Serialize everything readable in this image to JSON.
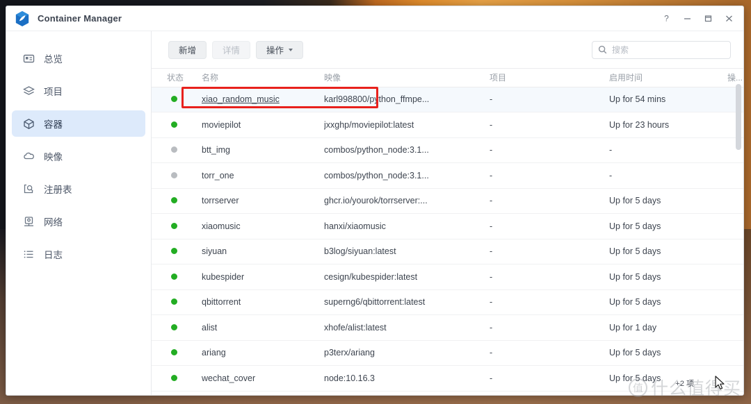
{
  "window": {
    "app_title": "Container Manager",
    "logo_icon": "synology-container-hexagon-logo",
    "controls": [
      {
        "name": "help-button",
        "icon": "question-mark-icon",
        "glyph": "?"
      },
      {
        "name": "minimize-button",
        "icon": "minimize-icon",
        "glyph": "–"
      },
      {
        "name": "maximize-button",
        "icon": "maximize-icon",
        "glyph": "□"
      },
      {
        "name": "close-button",
        "icon": "close-icon",
        "glyph": "×"
      }
    ]
  },
  "sidebar": {
    "items": [
      {
        "label": "总览",
        "icon": "overview-card-icon",
        "active": false
      },
      {
        "label": "项目",
        "icon": "layers-project-icon",
        "active": false
      },
      {
        "label": "容器",
        "icon": "cube-container-icon",
        "active": true
      },
      {
        "label": "映像",
        "icon": "cloud-image-icon",
        "active": false
      },
      {
        "label": "注册表",
        "icon": "registry-search-icon",
        "active": false
      },
      {
        "label": "网络",
        "icon": "network-icon",
        "active": false
      },
      {
        "label": "日志",
        "icon": "log-list-icon",
        "active": false
      }
    ]
  },
  "toolbar": {
    "create_label": "新增",
    "details_label": "详情",
    "details_disabled": true,
    "actions_label": "操作",
    "actions_has_caret": true,
    "search_placeholder": "搜索",
    "search_value": ""
  },
  "table": {
    "columns": [
      {
        "key": "status",
        "label": "状态"
      },
      {
        "key": "name",
        "label": "名称"
      },
      {
        "key": "image",
        "label": "映像"
      },
      {
        "key": "project",
        "label": "项目"
      },
      {
        "key": "uptime",
        "label": "启用时间"
      },
      {
        "key": "action",
        "label": "操..."
      },
      {
        "key": "cog",
        "label": ""
      }
    ],
    "rows": [
      {
        "status": "up",
        "name": "xiao_random_music",
        "image": "karl998800/python_ffmpe...",
        "project": "-",
        "uptime": "Up for 54 mins",
        "selected": true,
        "name_underlined": true
      },
      {
        "status": "up",
        "name": "moviepilot",
        "image": "jxxghp/moviepilot:latest",
        "project": "-",
        "uptime": "Up for 23 hours",
        "selected": false,
        "name_underlined": false
      },
      {
        "status": "down",
        "name": "btt_img",
        "image": "combos/python_node:3.1...",
        "project": "-",
        "uptime": "-",
        "selected": false,
        "name_underlined": false
      },
      {
        "status": "down",
        "name": "torr_one",
        "image": "combos/python_node:3.1...",
        "project": "-",
        "uptime": "-",
        "selected": false,
        "name_underlined": false
      },
      {
        "status": "up",
        "name": "torrserver",
        "image": "ghcr.io/yourok/torrserver:...",
        "project": "-",
        "uptime": "Up for 5 days",
        "selected": false,
        "name_underlined": false
      },
      {
        "status": "up",
        "name": "xiaomusic",
        "image": "hanxi/xiaomusic",
        "project": "-",
        "uptime": "Up for 5 days",
        "selected": false,
        "name_underlined": false
      },
      {
        "status": "up",
        "name": "siyuan",
        "image": "b3log/siyuan:latest",
        "project": "-",
        "uptime": "Up for 5 days",
        "selected": false,
        "name_underlined": false
      },
      {
        "status": "up",
        "name": "kubespider",
        "image": "cesign/kubespider:latest",
        "project": "-",
        "uptime": "Up for 5 days",
        "selected": false,
        "name_underlined": false
      },
      {
        "status": "up",
        "name": "qbittorrent",
        "image": "superng6/qbittorrent:latest",
        "project": "-",
        "uptime": "Up for 5 days",
        "selected": false,
        "name_underlined": false
      },
      {
        "status": "up",
        "name": "alist",
        "image": "xhofe/alist:latest",
        "project": "-",
        "uptime": "Up for 1 day",
        "selected": false,
        "name_underlined": false
      },
      {
        "status": "up",
        "name": "ariang",
        "image": "p3terx/ariang",
        "project": "-",
        "uptime": "Up for 5 days",
        "selected": false,
        "name_underlined": false
      },
      {
        "status": "up",
        "name": "wechat_cover",
        "image": "node:10.16.3",
        "project": "-",
        "uptime": "Up for 5 days",
        "selected": false,
        "name_underlined": false
      }
    ]
  },
  "annotation": {
    "type": "red-highlight-rectangle",
    "color": "#e8211c",
    "targets_row": "xiao_random_music"
  },
  "overlay": {
    "watermark_badge": "值",
    "watermark_text": "什么值得买",
    "extra_count_text": "+2 项",
    "cursor_icon": "mouse-pointer-arrow-icon"
  },
  "colors": {
    "accent_selected": "#ddeafb",
    "status_up": "#23ad23",
    "status_down": "#b9bcc0",
    "annotation_red": "#e8211c"
  }
}
